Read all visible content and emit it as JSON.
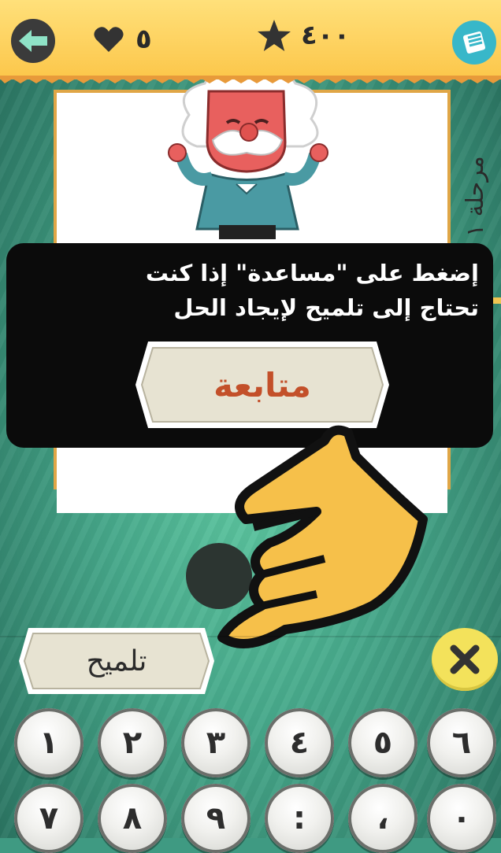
{
  "header": {
    "lives": "٥",
    "score": "٤٠٠"
  },
  "level": {
    "label": "مرحلة ١"
  },
  "tooltip": {
    "line1": "إضغط على \"مساعدة\" إذا كنت",
    "line2": "تحتاج إلى تلميح لإيجاد الحل",
    "continue_label": "متابعة"
  },
  "controls": {
    "hint_label": "تلميح"
  },
  "keypad": {
    "row1": [
      "١",
      "٢",
      "٣",
      "٤",
      "٥",
      "٦"
    ],
    "row2": [
      "٧",
      "٨",
      "٩",
      ":",
      "،",
      "٠"
    ]
  },
  "colors": {
    "topbar": "#fcc74b",
    "background": "#47a98b",
    "continue_text": "#c3502a",
    "menu_button": "#38b7c9",
    "delete_button": "#f3e25b"
  }
}
